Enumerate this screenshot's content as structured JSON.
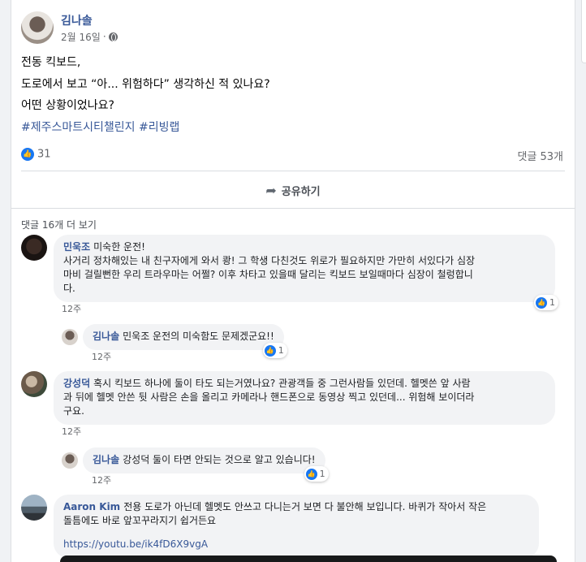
{
  "post": {
    "author": "김나솔",
    "date": "2월 16일",
    "separator": "·",
    "lines": [
      "전동 킥보드,",
      "도로에서 보고 “아... 위험하다” 생각하신 적 있나요?",
      "어떤 상황이었나요?"
    ],
    "hashtags": [
      "#제주스마트시티챌린지",
      "#리빙랩"
    ],
    "reaction_count": "31",
    "comment_count": "댓글 53개",
    "share_label": "공유하기"
  },
  "comments_section": {
    "more_label": "댓글 16개 더 보기",
    "items": [
      {
        "name": "민욱조",
        "text": "미숙한 운전! 사거리 정차해있는 내 친구자에게 와서 쾅! 그 학생 다친것도 위로가 필요하지만 가만히 서있다가 심장마비 걸릴뻔한 우리 트라우마는 어쩔? 이후 차타고 있을때 달리는 킥보드 보일때마다 심장이 철렁합니다.",
        "line1": "사거리 정차해있는 내 친구자에게 와서 쾅! 그 학생 다친것도 위로가 필요하지만 가만히 서있다가 심장",
        "line2": "마비 걸릴뻔한 우리 트라우마는 어쩔? 이후 차타고 있을때 달리는 킥보드 보일때마다 심장이 철렁합니",
        "line3": "다.",
        "first": "미숙한 운전!",
        "time": "12주",
        "likes": "1",
        "reply": {
          "name": "김나솔",
          "text": "민욱조 운전의 미숙함도 문제겠군요!!",
          "time": "12주",
          "likes": "1"
        }
      },
      {
        "name": "강성덕",
        "line1": "혹시 킥보드 하나에 둘이 타도 되는거였나요? 관광객들 중 그런사람들 있던데. 헬멧쓴 앞 사람",
        "line2": "과 뒤에 헬멧 안쓴 뒷 사람은 손을 올리고 카메라나 핸드폰으로 동영상 찍고 있던데... 위험해 보이더라",
        "line3": "구요.",
        "time": "12주",
        "reply": {
          "name": "김나솔",
          "text": "강성덕 둘이 타면 안되는 것으로 알고 있습니다!",
          "time": "12주",
          "likes": "1"
        }
      },
      {
        "name": "Aaron Kim",
        "line1": "전용 도로가 아닌데 헬멧도 안쓰고 다니는거 보면 다 불안해 보입니다. 바퀴가 작아서 작은",
        "line2": "돌틈에도 바로 앞꼬꾸라지기 쉽거든요",
        "link": "https://youtu.be/ik4fD6X9vgA"
      }
    ]
  },
  "colors": {
    "link": "#385898",
    "like": "#1877f2",
    "bubble": "#f2f3f5"
  }
}
